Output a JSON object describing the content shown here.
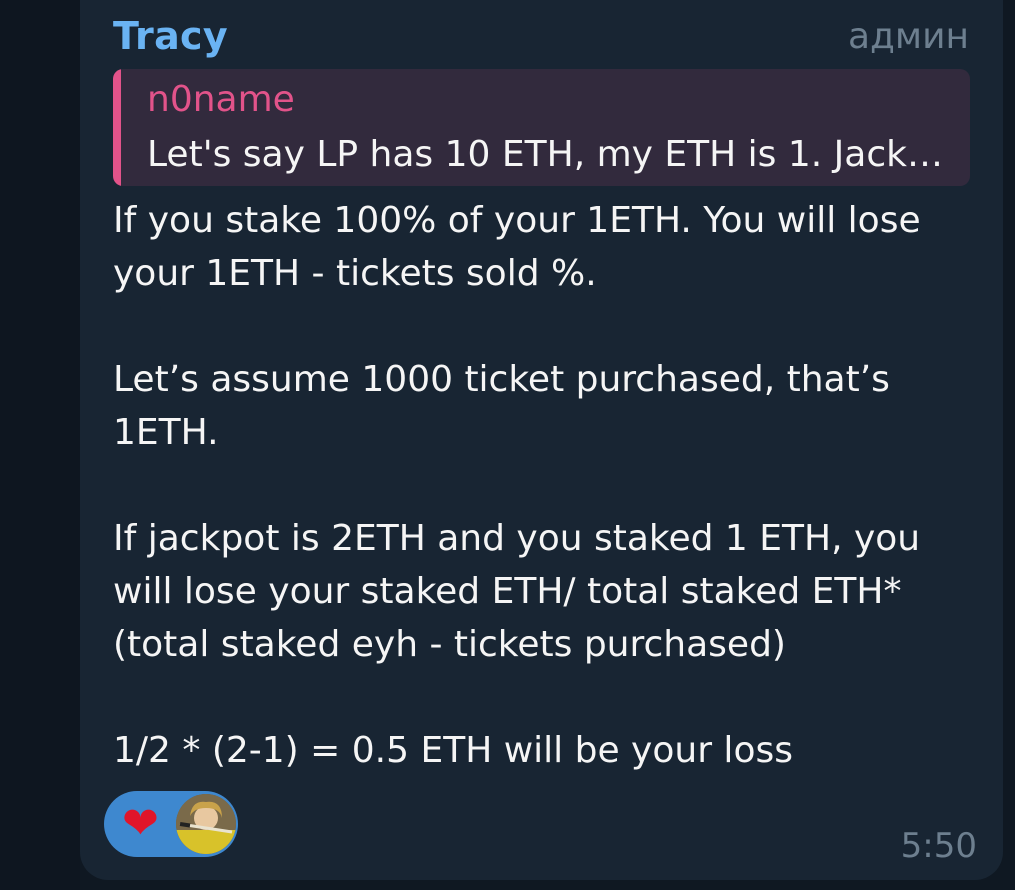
{
  "message": {
    "sender": "Tracy",
    "role": "админ",
    "reply": {
      "name": "n0name",
      "text": "Let's say LP has 10 ETH, my ETH is 1. Jackp..."
    },
    "paragraphs": [
      "If you stake 100% of your 1ETH. You will lose your 1ETH - tickets sold %.",
      "",
      "Let’s assume 1000 ticket purchased, that’s 1ETH.",
      "",
      "If jackpot is 2ETH and you staked 1 ETH, you will lose your staked ETH/ total staked ETH* (total staked eyh - tickets purchased)",
      "",
      "1/2 * (2-1) = 0.5 ETH will be your loss"
    ],
    "reaction": {
      "emoji": "❤",
      "icon": "heart-icon"
    },
    "time": "5:50"
  },
  "colors": {
    "background": "#0f1822",
    "bubble": "#182533",
    "sender": "#6ab3f3",
    "reply_accent": "#e2538a",
    "reply_bg": "#322a3d",
    "reaction_bg": "#3e88cf",
    "meta": "#6d7f8f",
    "text": "#f5f5f5"
  }
}
